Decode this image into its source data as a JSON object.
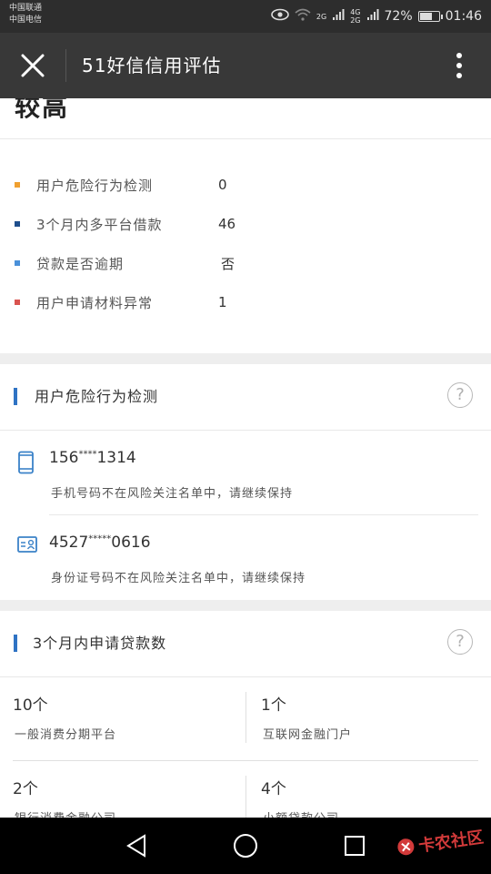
{
  "status": {
    "carrier_1": "中国联通",
    "carrier_2": "中国电信",
    "net_a": "2G",
    "net_b": "4G",
    "net_c": "2G",
    "battery": "72%",
    "battery_level": 0.72,
    "time": "01:46"
  },
  "appbar": {
    "title": "51好信信用评估"
  },
  "level": {
    "text": "较高"
  },
  "summary": {
    "rows": [
      {
        "label": "用户危险行为检测",
        "value": "0",
        "color": "#f0a030"
      },
      {
        "label": "3个月内多平台借款",
        "value": "46",
        "color": "#1f4e8c"
      },
      {
        "label": "贷款是否逾期",
        "value": "否",
        "color": "#4a90d9"
      },
      {
        "label": "用户申请材料异常",
        "value": "1",
        "color": "#d9534f"
      }
    ]
  },
  "risk_section": {
    "title": "用户危险行为检测",
    "help": "?",
    "phone": {
      "prefix": "156",
      "mask": "****",
      "suffix": "1314",
      "desc": "手机号码不在风险关注名单中，请继续保持"
    },
    "idcard": {
      "prefix": "4527",
      "mask": "*****",
      "suffix": "0616",
      "desc": "身份证号码不在风险关注名单中，请继续保持"
    }
  },
  "loan_section": {
    "title": "3个月内申请贷款数",
    "help": "?",
    "cells": [
      {
        "num": "10个",
        "desc": "一般消费分期平台"
      },
      {
        "num": "1个",
        "desc": "互联网金融门户"
      },
      {
        "num": "2个",
        "desc": "银行消费金融公司"
      },
      {
        "num": "4个",
        "desc": "小额贷款公司"
      }
    ]
  },
  "watermark": {
    "text": "卡农社区"
  },
  "colors": {
    "accent_blue": "#2f73c4",
    "appbar_bg": "#383838",
    "statusbar_bg": "#2d2d2d"
  }
}
